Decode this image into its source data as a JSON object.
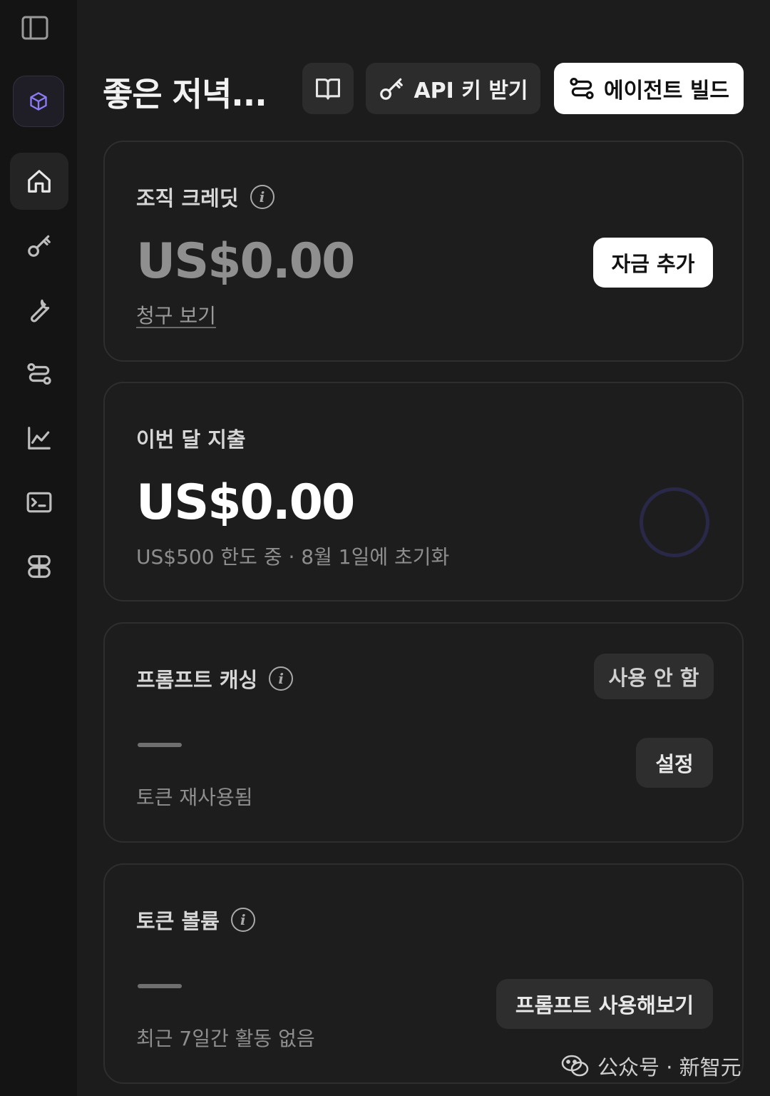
{
  "header": {
    "greeting": "좋은 저녁...",
    "docs_icon": "book-icon",
    "api_button_label": "API 키 받기",
    "agent_button_label": "에이전트 빌드"
  },
  "sidebar": {
    "toggle_icon": "sidebar-toggle-icon",
    "brand_icon": "cube-icon",
    "items": [
      {
        "icon": "home-icon",
        "active": true
      },
      {
        "icon": "key-icon",
        "active": false
      },
      {
        "icon": "wrench-icon",
        "active": false
      },
      {
        "icon": "agent-icon",
        "active": false
      },
      {
        "icon": "chart-icon",
        "active": false
      },
      {
        "icon": "terminal-icon",
        "active": false
      },
      {
        "icon": "pills-icon",
        "active": false
      }
    ]
  },
  "credits": {
    "title": "조직 크레딧",
    "amount": "US$0.00",
    "billing_link": "청구 보기",
    "add_funds_label": "자금 추가"
  },
  "spend": {
    "title": "이번 달 지출",
    "amount": "US$0.00",
    "limit_text": "US$500 한도 중 · 8월 1일에 초기화",
    "progress": 0
  },
  "caching": {
    "title": "프롬프트 캐싱",
    "status_label": "사용 안 함",
    "value": "—",
    "subtext": "토큰 재사용됨",
    "settings_label": "설정"
  },
  "volume": {
    "title": "토큰 볼륨",
    "value": "—",
    "subtext": "최근 7일간 활동 없음",
    "try_button_label": "프롬프트 사용해보기"
  },
  "watermark": {
    "text": "公众号 · 新智元"
  },
  "colors": {
    "background": "#1c1c1c",
    "sidebar": "#141414",
    "accent": "#7b6cf0"
  }
}
